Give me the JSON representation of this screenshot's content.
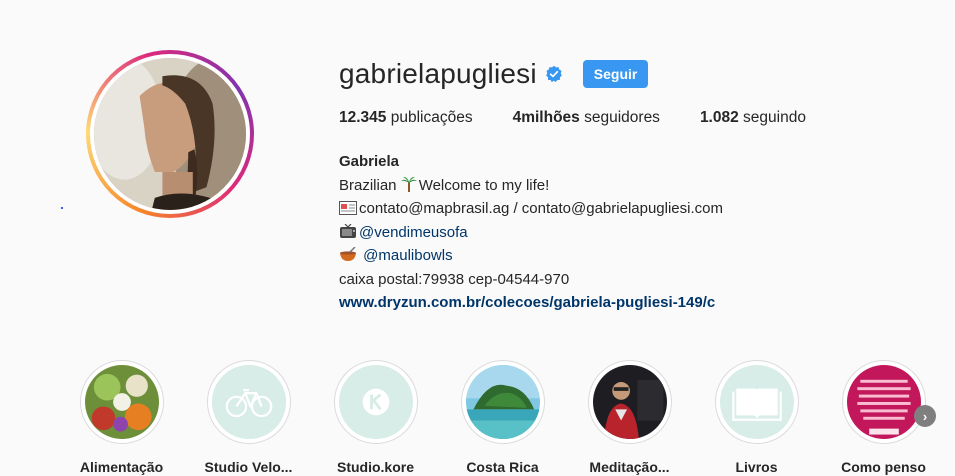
{
  "profile": {
    "username": "gabrielapugliesi",
    "follow_label": "Seguir",
    "stats": {
      "posts_count": "12.345",
      "posts_label": "publicações",
      "followers_count": "4milhões",
      "followers_label": "seguidores",
      "following_count": "1.082",
      "following_label": "seguindo"
    },
    "bio": {
      "name": "Gabriela",
      "line1": "Brazilian",
      "line1b": "Welcome to my life!",
      "line2": "contato@mapbrasil.ag / contato@gabrielapugliesi.com",
      "line3": "@vendimeusofa",
      "line4": "@maulibowls",
      "line5": "caixa postal:79938 cep-04544-970",
      "link": "www.dryzun.com.br/colecoes/gabriela-pugliesi-149/c"
    }
  },
  "highlights": [
    {
      "label": "Alimentação",
      "icon": "food-photo"
    },
    {
      "label": "Studio Velo...",
      "icon": "bicycle-icon"
    },
    {
      "label": "Studio.kore",
      "icon": "kore-logo-icon"
    },
    {
      "label": "Costa Rica",
      "icon": "island-photo"
    },
    {
      "label": "Meditação...",
      "icon": "person-photo"
    },
    {
      "label": "Livros",
      "icon": "book-icon"
    },
    {
      "label": "Como penso",
      "icon": "text-card-photo"
    }
  ],
  "colors": {
    "accent": "#3897f0",
    "mint": "#d8ede7",
    "link": "#003569"
  }
}
